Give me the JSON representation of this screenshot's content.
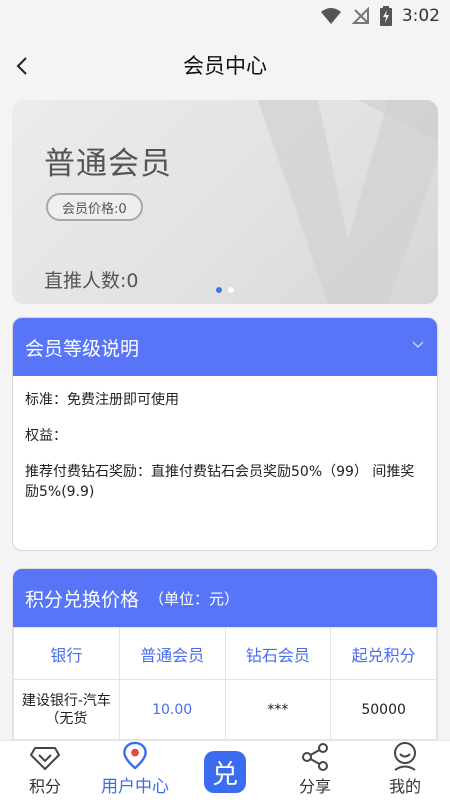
{
  "status": {
    "time": "3:02"
  },
  "header": {
    "title": "会员中心"
  },
  "card": {
    "level": "普通会员",
    "price": "会员价格:0",
    "referrals": "直推人数:0",
    "slide_count": 2,
    "active_slide": 0
  },
  "level_panel": {
    "title": "会员等级说明",
    "lines": [
      "标准：免费注册即可使用",
      "权益：",
      "推荐付费钻石奖励：直推付费钻石会员奖励50%（99） 间推奖励5%(9.9)"
    ]
  },
  "exchange": {
    "title": "积分兑换价格",
    "unit": "（单位：元）",
    "headers": [
      "银行",
      "普通会员",
      "钻石会员",
      "起兑积分"
    ],
    "rows": [
      {
        "bank": "建设银行-汽车（无货",
        "regular": "10.00",
        "diamond": "***",
        "min_points": "50000"
      }
    ]
  },
  "tabbar": {
    "items": [
      {
        "label": "积分",
        "icon": "diamond-icon"
      },
      {
        "label": "用户中心",
        "icon": "location-pin-icon",
        "active": true
      },
      {
        "label": "兑",
        "icon": "exchange-icon"
      },
      {
        "label": "分享",
        "icon": "share-icon"
      },
      {
        "label": "我的",
        "icon": "profile-icon"
      }
    ]
  },
  "colors": {
    "accent": "#5775f6",
    "tab_active": "#3b6cf0",
    "card_bg": "#e1e1e1"
  }
}
